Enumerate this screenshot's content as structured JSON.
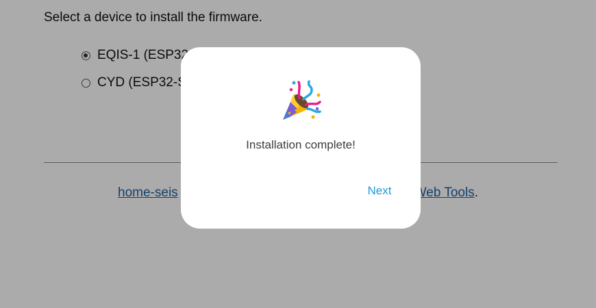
{
  "page": {
    "prompt": "Select a device to install the firmware.",
    "devices": [
      {
        "label": "EQIS-1 (ESP32",
        "selected": true
      },
      {
        "label": "CYD (ESP32-S",
        "selected": false
      }
    ],
    "footer": {
      "link_left": "home-seis",
      "link_right": "Web Tools",
      "trailing": "."
    }
  },
  "dialog": {
    "icon": "party-popper-icon",
    "message": "Installation complete!",
    "next_label": "Next"
  },
  "colors": {
    "overlay": "#adadad",
    "accent": "#1a9ad6",
    "link": "#1f5f9e"
  }
}
